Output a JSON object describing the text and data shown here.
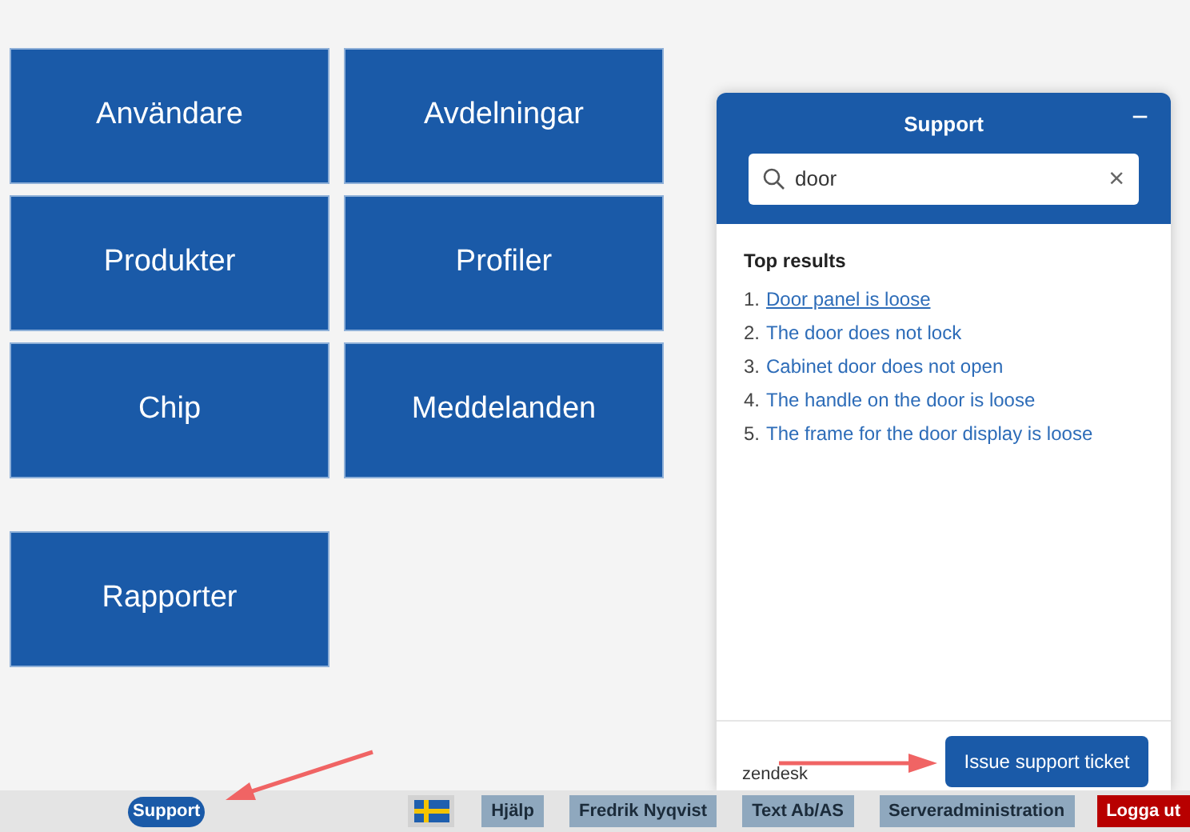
{
  "tiles": [
    {
      "label": "Användare"
    },
    {
      "label": "Avdelningar"
    },
    {
      "label": "Produkter"
    },
    {
      "label": "Profiler"
    },
    {
      "label": "Chip"
    },
    {
      "label": "Meddelanden"
    },
    {
      "label": "Rapporter"
    }
  ],
  "support_panel": {
    "title": "Support",
    "minimize": "−",
    "search": {
      "value": "door",
      "clear": "×"
    },
    "results_heading": "Top results",
    "results": [
      {
        "number": "1.",
        "title": "Door panel is loose",
        "hovered": true
      },
      {
        "number": "2.",
        "title": "The door does not lock",
        "hovered": false
      },
      {
        "number": "3.",
        "title": "Cabinet door does not open",
        "hovered": false
      },
      {
        "number": "4.",
        "title": "The handle on the door is loose",
        "hovered": false
      },
      {
        "number": "5.",
        "title": "The frame for the door display is loose",
        "hovered": false
      }
    ],
    "brand": "zendesk",
    "ticket_button": "Issue support ticket"
  },
  "bottom_bar": {
    "support_button": "Support",
    "items": [
      {
        "kind": "flag"
      },
      {
        "kind": "button",
        "label": "Hjälp"
      },
      {
        "kind": "button",
        "label": "Fredrik Nyqvist"
      },
      {
        "kind": "button",
        "label": "Text Ab/AS"
      },
      {
        "kind": "button",
        "label": "Serveradministration"
      },
      {
        "kind": "logout",
        "label": "Logga ut"
      }
    ]
  }
}
